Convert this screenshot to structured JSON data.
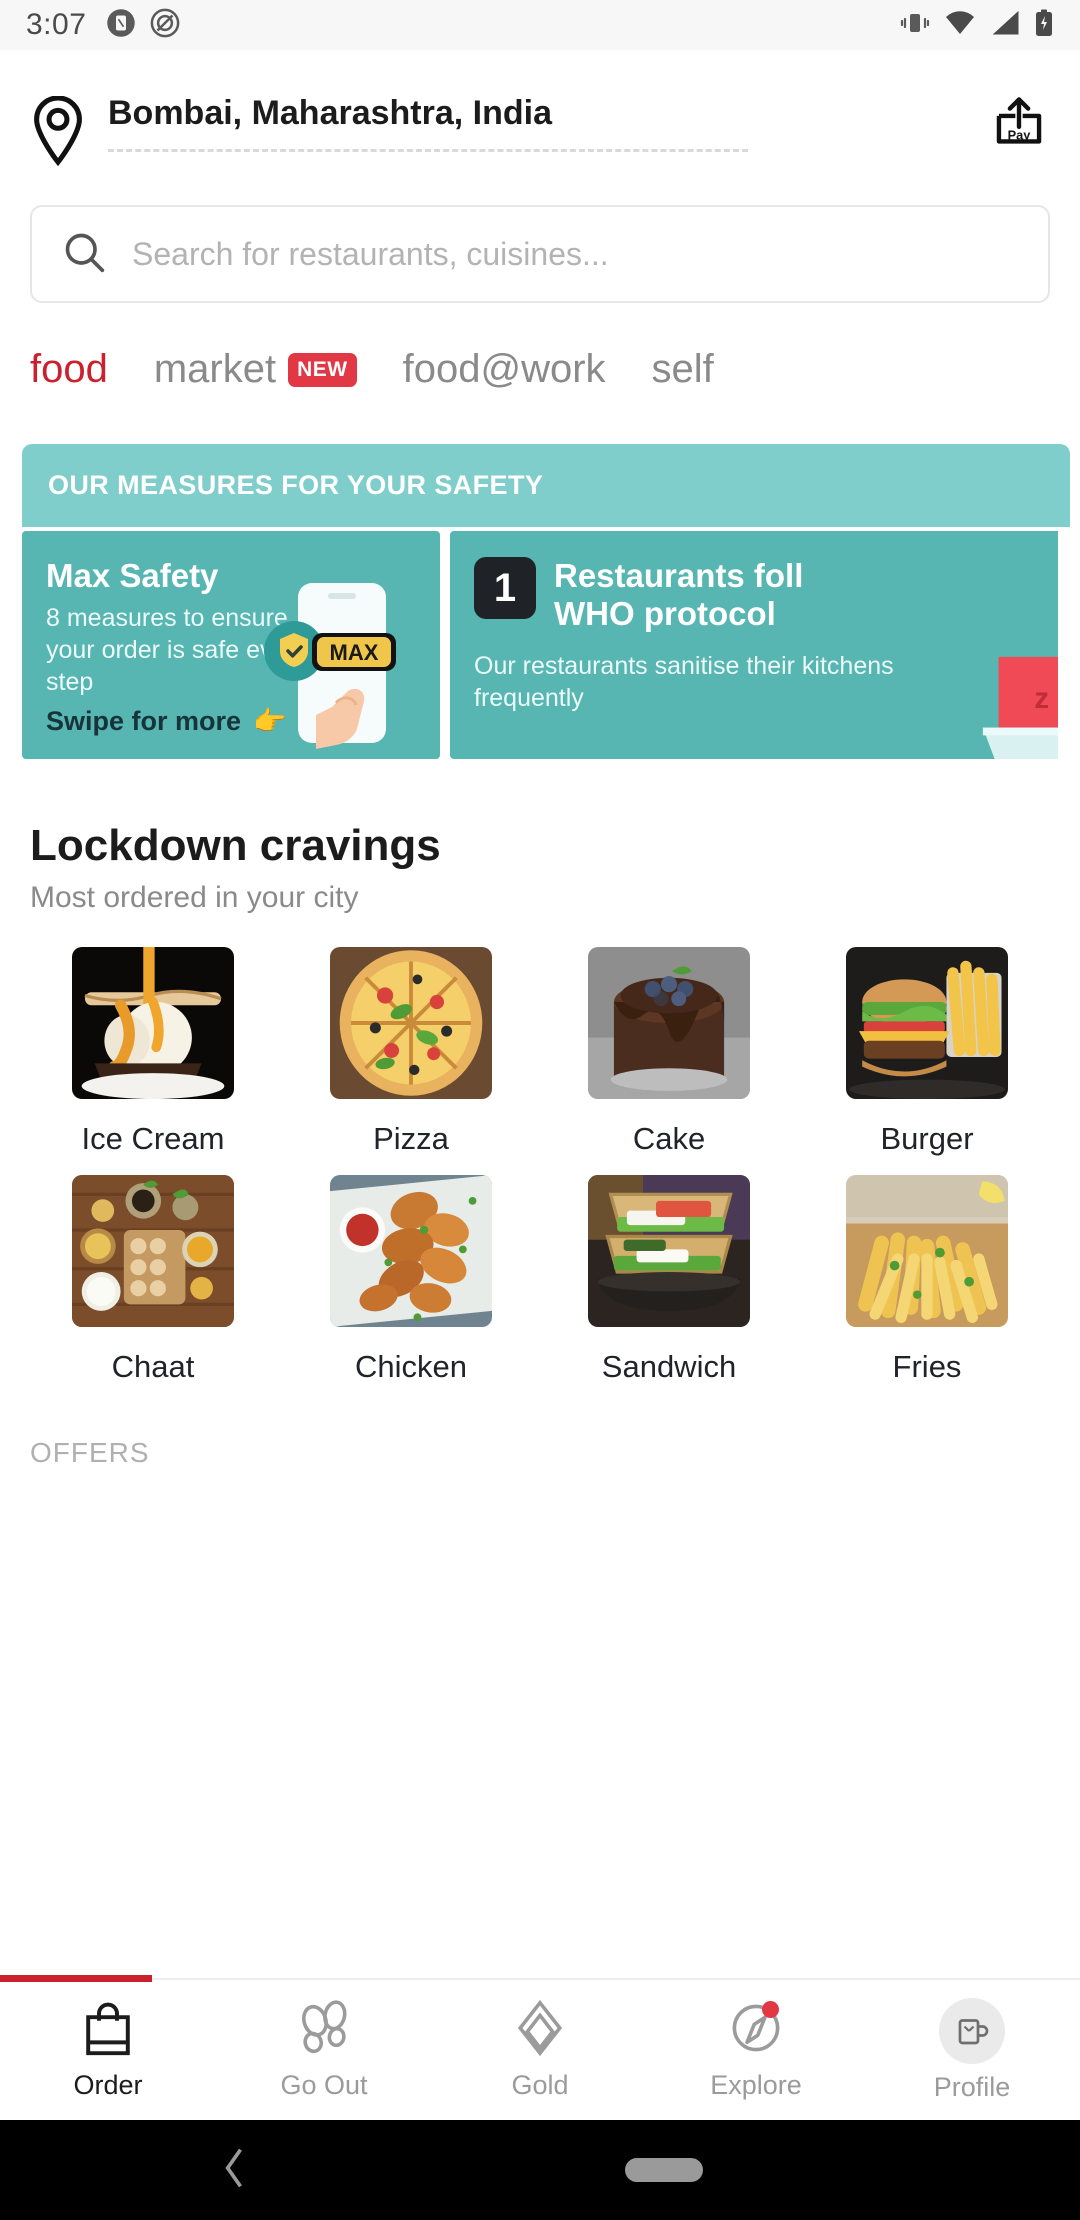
{
  "status_bar": {
    "time": "3:07",
    "left_icons": [
      "screenshot-icon",
      "do-not-disturb-icon"
    ],
    "right_icons": [
      "vibrate-icon",
      "wifi-icon",
      "signal-icon",
      "battery-charging-icon"
    ]
  },
  "header": {
    "location": "Bombai, Maharashtra, India",
    "pin_icon": "location-pin-icon",
    "pay_icon": "pay-icon",
    "pay_label": "Pay"
  },
  "search": {
    "placeholder": "Search for restaurants, cuisines...",
    "icon": "search-icon"
  },
  "tabs": [
    {
      "label": "food",
      "active": true,
      "badge": ""
    },
    {
      "label": "market",
      "active": false,
      "badge": "NEW"
    },
    {
      "label": "food@work",
      "active": false,
      "badge": ""
    },
    {
      "label": "self",
      "active": false,
      "badge": ""
    }
  ],
  "safety": {
    "banner_title": "OUR MEASURES FOR YOUR SAFETY",
    "cards": [
      {
        "title": "Max Safety",
        "body": "8 measures to ensure your order is safe every step",
        "swipe_text": "Swipe for more",
        "swipe_emoji": "👉",
        "badge_text": "MAX"
      },
      {
        "number": "1",
        "title": "Restaurants foll",
        "title_line2": "WHO protocol",
        "body": "Our restaurants sanitise their kitchens frequently"
      }
    ]
  },
  "section": {
    "title": "Lockdown cravings",
    "subtitle": "Most ordered in your city"
  },
  "categories": [
    {
      "label": "Ice Cream"
    },
    {
      "label": "Pizza"
    },
    {
      "label": "Cake"
    },
    {
      "label": "Burger"
    },
    {
      "label": "Chaat"
    },
    {
      "label": "Chicken"
    },
    {
      "label": "Sandwich"
    },
    {
      "label": "Fries"
    }
  ],
  "offers": {
    "label": "OFFERS"
  },
  "bottom_nav": [
    {
      "label": "Order",
      "icon": "shopping-bag-icon",
      "active": true,
      "dot": false
    },
    {
      "label": "Go Out",
      "icon": "footsteps-icon",
      "active": false,
      "dot": false
    },
    {
      "label": "Gold",
      "icon": "gold-diamond-icon",
      "active": false,
      "dot": false
    },
    {
      "label": "Explore",
      "icon": "compass-icon",
      "active": false,
      "dot": true
    },
    {
      "label": "Profile",
      "icon": "profile-mug-icon",
      "active": false,
      "dot": false
    }
  ],
  "android_nav": {
    "back_icon": "back-chevron-icon",
    "home_icon": "home-pill-icon"
  },
  "colors": {
    "accent_red": "#cb202d",
    "badge_red": "#e23744",
    "teal_header": "#7fcecb",
    "teal_card": "#57b5b2",
    "text_dark": "#1c1c1c",
    "text_muted": "#8a8a8a"
  }
}
